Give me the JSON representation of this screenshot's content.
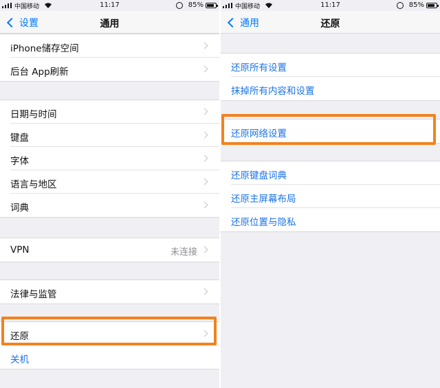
{
  "left": {
    "status": {
      "carrier": "中国移动",
      "time": "11:17",
      "battery": "85%",
      "battery_level": 0.85
    },
    "nav": {
      "back_label": "设置",
      "title": "通用"
    },
    "groups": [
      [
        {
          "label": "iPhone储存空间"
        },
        {
          "label": "后台 App刷新"
        }
      ],
      [
        {
          "label": "日期与时间"
        },
        {
          "label": "键盘"
        },
        {
          "label": "字体"
        },
        {
          "label": "语言与地区"
        },
        {
          "label": "词典"
        }
      ],
      [
        {
          "label": "VPN",
          "detail": "未连接"
        }
      ],
      [
        {
          "label": "法律与监管"
        }
      ],
      [
        {
          "label": "还原"
        },
        {
          "label": "关机"
        }
      ]
    ]
  },
  "right": {
    "status": {
      "carrier": "中国移动",
      "time": "11:17",
      "battery": "85%",
      "battery_level": 0.85
    },
    "nav": {
      "back_label": "通用",
      "title": "还原"
    },
    "groups": [
      [
        {
          "label": "还原所有设置"
        },
        {
          "label": "抹掉所有内容和设置"
        }
      ],
      [
        {
          "label": "还原网络设置"
        }
      ],
      [
        {
          "label": "还原键盘词典"
        },
        {
          "label": "还原主屏幕布局"
        },
        {
          "label": "还原位置与隐私"
        }
      ]
    ]
  },
  "colors": {
    "accent": "#007aff",
    "link": "#1a73e8",
    "highlight": "#f2821e",
    "background": "#efeff4"
  }
}
